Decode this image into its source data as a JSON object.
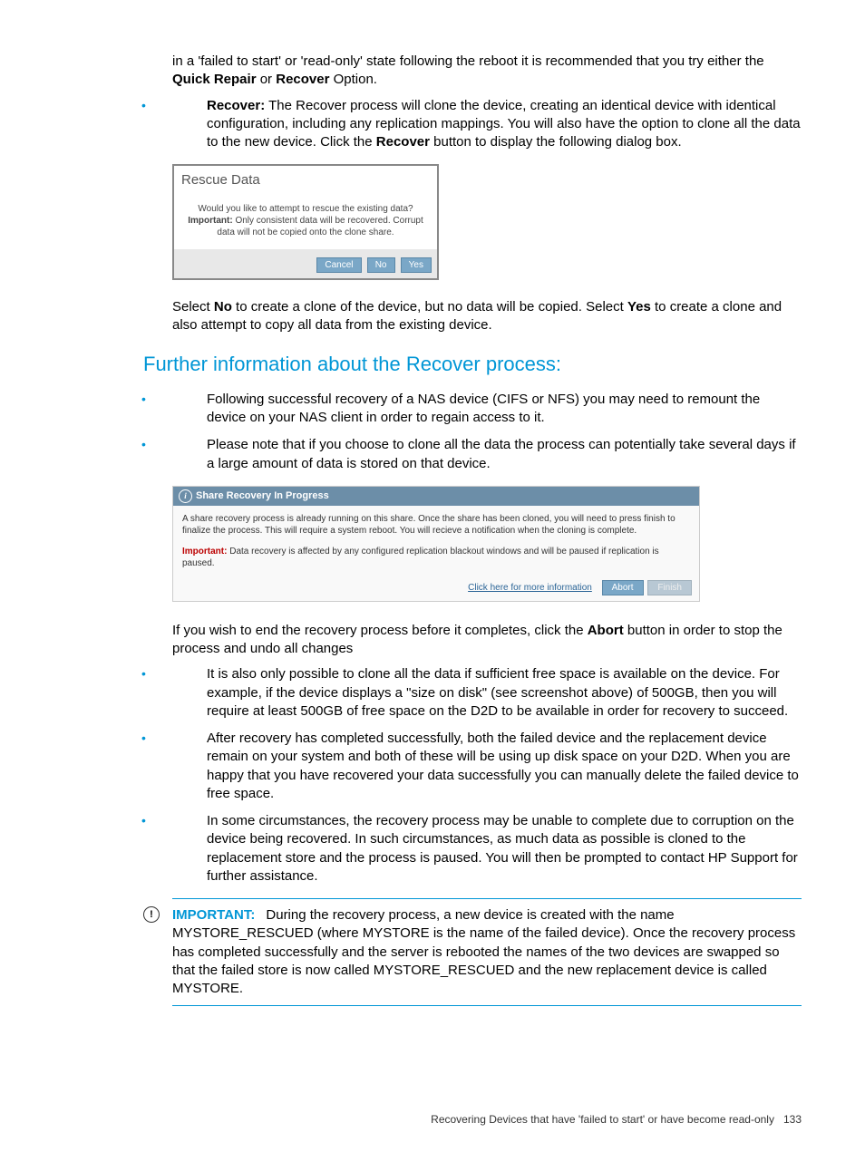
{
  "intro": {
    "p1_part1": "in a 'failed to start' or 'read-only' state following the reboot it is recommended that you try either the ",
    "p1_b1": "Quick Repair",
    "p1_mid": " or ",
    "p1_b2": "Recover",
    "p1_part2": " Option."
  },
  "recover": {
    "lead": "Recover:",
    "body_part1": " The Recover process will clone the device, creating an identical device with identical configuration, including any replication mappings. You will also have the option to clone all the data to the new device. Click the ",
    "body_b": "Recover",
    "body_part2": " button to display the following dialog box."
  },
  "dialog1": {
    "title": "Rescue Data",
    "line1": "Would you like to attempt to rescue the existing data?",
    "imp": "Important:",
    "line2": " Only consistent data will be recovered. Corrupt data will not be copied onto the clone share.",
    "cancel": "Cancel",
    "no": "No",
    "yes": "Yes"
  },
  "post_dialog": {
    "p_part1": "Select ",
    "b1": "No",
    "p_part2": " to create a clone of the device, but no data will be copied. Select ",
    "b2": "Yes",
    "p_part3": " to create a clone and also attempt to copy all data from the existing device."
  },
  "heading": "Further information about the Recover process:",
  "bullets1": {
    "b1": "Following successful recovery of a NAS device (CIFS or NFS) you may need to remount the device on your NAS client in order to regain access to it.",
    "b2": "Please note that if you choose to clone all the data the process can potentially take several days if a large amount of data is stored on that device."
  },
  "panel": {
    "title": "Share Recovery In Progress",
    "body1": "A share recovery process is already running on this share. Once the share has been cloned, you will need to press finish to finalize the process. This will require a system reboot. You will recieve a notification when the cloning is complete.",
    "imp": "Important:",
    "body2": " Data recovery is affected by any configured replication blackout windows and will be paused if replication is paused.",
    "link": "Click here for more information",
    "abort": "Abort",
    "finish": "Finish"
  },
  "post_panel": {
    "p_part1": "If you wish to end the recovery process before it completes, click the ",
    "b": "Abort",
    "p_part2": " button in order to stop the process and undo all changes"
  },
  "bullets2": {
    "b1": "It is also only possible to clone all the data if sufficient free space is available on the device. For example, if the device displays a \"size on disk\" (see screenshot above) of 500GB, then you will require at least 500GB of free space on the D2D to be available in order for recovery to succeed.",
    "b2": "After recovery has completed successfully, both the failed device and the replacement device remain on your system and both of these will be using up disk space on your D2D. When you are happy that you have recovered your data successfully you can manually delete the failed device to free space.",
    "b3": "In some circumstances, the recovery process may be unable to complete due to corruption on the device being recovered. In such circumstances, as much data as possible is cloned to the replacement store and the process is paused. You will then be prompted to contact HP Support for further assistance."
  },
  "note": {
    "lead": "IMPORTANT:",
    "body": "During the recovery process, a new device is created with the name MYSTORE_RESCUED (where MYSTORE is the name of the failed device). Once the recovery process has completed successfully and the server is rebooted the names of the two devices are swapped so that the failed store is now called MYSTORE_RESCUED and the new replacement device is called MYSTORE."
  },
  "footer": {
    "text": "Recovering Devices that have 'failed to start' or have become read-only",
    "page": "133"
  }
}
